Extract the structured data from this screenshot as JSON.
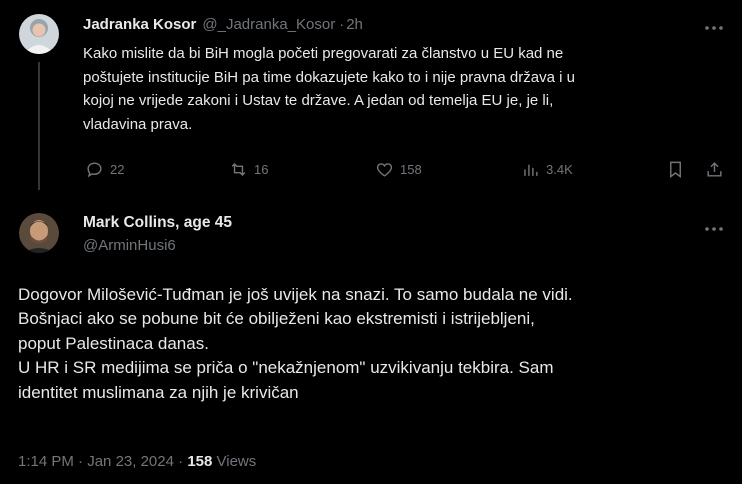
{
  "tweet1": {
    "author_name": "Jadranka Kosor",
    "handle": "@_Jadranka_Kosor",
    "separator": "·",
    "time": "2h",
    "text_lines": [
      "Kako mislite da bi BiH mogla početi pregovarati za članstvo u EU kad ne",
      "poštujete institucije BiH pa time dokazujete kako to i nije pravna država i u",
      "kojoj ne vrijede zakoni i Ustav te države. A jedan od temelja EU je, je li,",
      "vladavina prava."
    ],
    "actions": {
      "replies": "22",
      "retweets": "16",
      "likes": "158",
      "views": "3.4K"
    },
    "icons": [
      "reply-icon",
      "retweet-icon",
      "like-icon",
      "views-icon",
      "bookmark-icon",
      "share-icon",
      "more-icon"
    ]
  },
  "tweet2": {
    "author_name": "Mark Collins, age 45",
    "handle": "@ArminHusi6",
    "text_lines": [
      "Dogovor Milošević-Tuđman je još uvijek na snazi. To samo budala ne vidi.",
      "Bošnjaci ako se pobune bit će obilježeni kao ekstremisti i istrijebljeni,",
      "poput Palestinaca danas.",
      "U HR i SR medijima se priča o \"nekažnjenom\" uzvikivanju tekbira. Sam",
      "identitet muslimana za njih je kriv­ičan"
    ],
    "footer": {
      "time": "1:14 PM",
      "separator": "·",
      "date": "Jan 23, 2024",
      "separator2": "·",
      "views_count": "158",
      "views_label": "Views"
    }
  },
  "colors": {
    "background": "#000000",
    "text": "#e7e9ea",
    "muted": "#71767b"
  }
}
